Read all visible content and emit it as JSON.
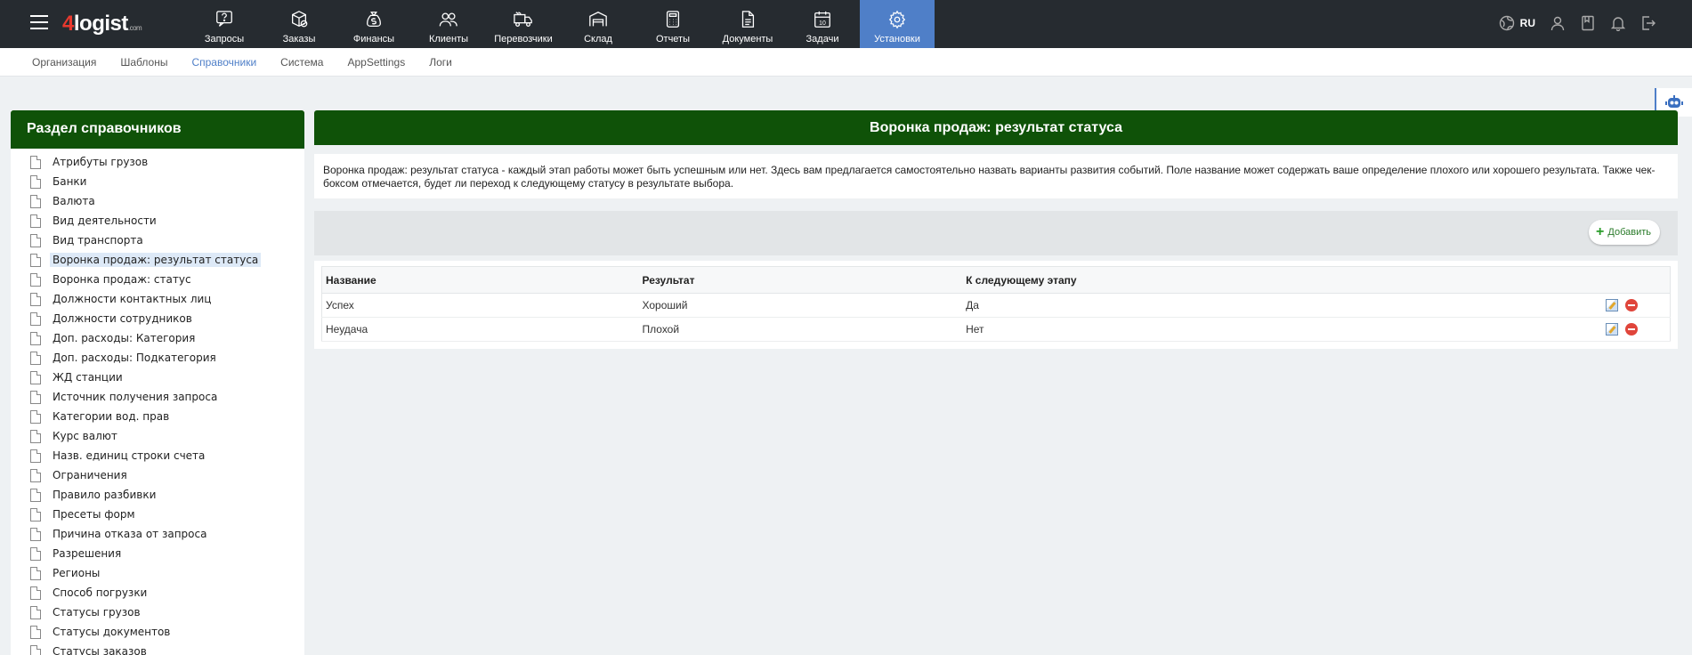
{
  "header": {
    "logo_num": "4",
    "logo_word": "logist",
    "logo_domain": ".com",
    "nav": [
      {
        "label": "Запросы",
        "icon": "question-box-icon"
      },
      {
        "label": "Заказы",
        "icon": "package-check-icon"
      },
      {
        "label": "Финансы",
        "icon": "money-bag-icon"
      },
      {
        "label": "Клиенты",
        "icon": "users-icon"
      },
      {
        "label": "Перевозчики",
        "icon": "truck-icon"
      },
      {
        "label": "Склад",
        "icon": "warehouse-icon"
      },
      {
        "label": "Отчеты",
        "icon": "calculator-icon"
      },
      {
        "label": "Документы",
        "icon": "document-icon"
      },
      {
        "label": "Задачи",
        "icon": "calendar-icon"
      },
      {
        "label": "Установки",
        "icon": "gear-icon",
        "active": true
      }
    ],
    "lang": "RU",
    "accent": "#4f7fc8"
  },
  "subnav": [
    {
      "label": "Организация"
    },
    {
      "label": "Шаблоны"
    },
    {
      "label": "Справочники",
      "active": true
    },
    {
      "label": "Система"
    },
    {
      "label": "AppSettings"
    },
    {
      "label": "Логи"
    }
  ],
  "sidebar": {
    "title": "Раздел справочников",
    "items": [
      "Атрибуты грузов",
      "Банки",
      "Валюта",
      "Вид деятельности",
      "Вид транспорта",
      "Воронка продаж: результат статуса",
      "Воронка продаж: статус",
      "Должности контактных лиц",
      "Должности сотрудников",
      "Доп. расходы: Категория",
      "Доп. расходы: Подкатегория",
      "ЖД станции",
      "Источник получения запроса",
      "Категории вод. прав",
      "Курс валют",
      "Назв. единиц строки счета",
      "Ограничения",
      "Правило разбивки",
      "Пресеты форм",
      "Причина отказа от запроса",
      "Разрешения",
      "Регионы",
      "Способ погрузки",
      "Статусы грузов",
      "Статусы документов",
      "Статусы заказов"
    ],
    "selected_index": 5,
    "header_color": "#0f5208"
  },
  "main": {
    "title": "Воронка продаж: результат статуса",
    "description": "Воронка продаж: результат статуса - каждый этап работы может быть успешным или нет. Здесь вам предлагается самостоятельно назвать варианты развития событий. Поле название может содержать ваше определение плохого или хорошего результата. Также чек-боксом отмечается, будет ли переход к следующему статусу в результате выбора.",
    "add_label": "Добавить",
    "table": {
      "columns": [
        "Название",
        "Результат",
        "К следующему этапу"
      ],
      "rows": [
        [
          "Успех",
          "Хороший",
          "Да"
        ],
        [
          "Неудача",
          "Плохой",
          "Нет"
        ]
      ]
    }
  }
}
